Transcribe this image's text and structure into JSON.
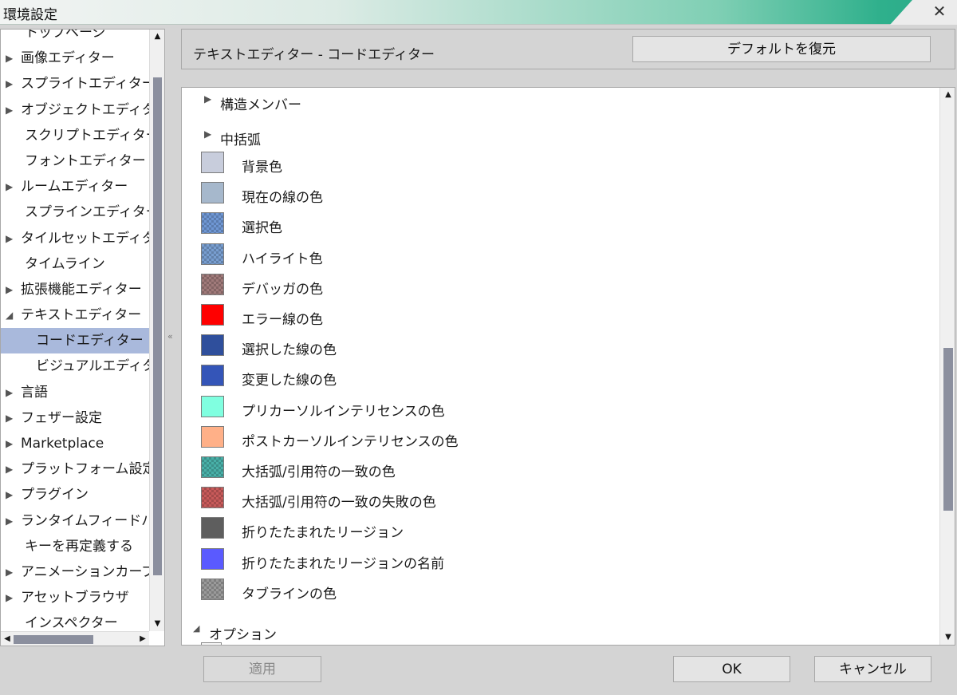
{
  "window": {
    "title": "環境設定",
    "close_symbol": "✕"
  },
  "tree": {
    "items": [
      {
        "label": "トップページ",
        "arrow": false,
        "level": 0,
        "selected": false
      },
      {
        "label": "画像エディター",
        "arrow": true,
        "level": 0,
        "selected": false
      },
      {
        "label": "スプライトエディター",
        "arrow": true,
        "level": 0,
        "selected": false
      },
      {
        "label": "オブジェクトエディター",
        "arrow": true,
        "level": 0,
        "selected": false
      },
      {
        "label": "スクリプトエディター",
        "arrow": false,
        "level": 0,
        "selected": false
      },
      {
        "label": "フォントエディター",
        "arrow": false,
        "level": 0,
        "selected": false
      },
      {
        "label": "ルームエディター",
        "arrow": true,
        "level": 0,
        "selected": false
      },
      {
        "label": "スプラインエディター",
        "arrow": false,
        "level": 0,
        "selected": false
      },
      {
        "label": "タイルセットエディター",
        "arrow": true,
        "level": 0,
        "selected": false
      },
      {
        "label": "タイムライン",
        "arrow": false,
        "level": 0,
        "selected": false
      },
      {
        "label": "拡張機能エディター",
        "arrow": true,
        "level": 0,
        "selected": false
      },
      {
        "label": "テキストエディター",
        "arrow": true,
        "expanded": true,
        "level": 0,
        "selected": false
      },
      {
        "label": "コードエディター",
        "arrow": false,
        "level": 1,
        "selected": true
      },
      {
        "label": "ビジュアルエディター",
        "arrow": false,
        "level": 1,
        "selected": false
      },
      {
        "label": "言語",
        "arrow": true,
        "level": 0,
        "selected": false
      },
      {
        "label": "フェザー設定",
        "arrow": true,
        "level": 0,
        "selected": false
      },
      {
        "label": "Marketplace",
        "arrow": true,
        "level": 0,
        "selected": false
      },
      {
        "label": "プラットフォーム設定",
        "arrow": true,
        "level": 0,
        "selected": false
      },
      {
        "label": "プラグイン",
        "arrow": true,
        "level": 0,
        "selected": false
      },
      {
        "label": "ランタイムフィードバック",
        "arrow": true,
        "level": 0,
        "selected": false
      },
      {
        "label": "キーを再定義する",
        "arrow": false,
        "level": 0,
        "selected": false
      },
      {
        "label": "アニメーションカーブ",
        "arrow": true,
        "level": 0,
        "selected": false
      },
      {
        "label": "アセットブラウザ",
        "arrow": true,
        "level": 0,
        "selected": false
      },
      {
        "label": "インスペクター",
        "arrow": false,
        "level": 0,
        "selected": false
      }
    ]
  },
  "header": {
    "title": "テキストエディター - コードエディター",
    "restore_label": "デフォルトを復元"
  },
  "content": {
    "sections": [
      {
        "label": "構造メンバー"
      },
      {
        "label": "中括弧"
      }
    ],
    "colors": [
      {
        "label": "背景色",
        "color": "#c8cddc",
        "checker": false
      },
      {
        "label": "現在の線の色",
        "color": "#a6b8cc",
        "checker": false
      },
      {
        "label": "選択色",
        "color": "#6f97d4",
        "checker": true
      },
      {
        "label": "ハイライト色",
        "color": "#789ed0",
        "checker": true
      },
      {
        "label": "デバッガの色",
        "color": "#a07a7a",
        "checker": true
      },
      {
        "label": "エラー線の色",
        "color": "#ff0000",
        "checker": false
      },
      {
        "label": "選択した線の色",
        "color": "#2f4f9c",
        "checker": false
      },
      {
        "label": "変更した線の色",
        "color": "#3455b8",
        "checker": false
      },
      {
        "label": "プリカーソルインテリセンスの色",
        "color": "#80ffe0",
        "checker": false
      },
      {
        "label": "ポストカーソルインテリセンスの色",
        "color": "#ffb088",
        "checker": false
      },
      {
        "label": "大括弧/引用符の一致の色",
        "color": "#48b0a8",
        "checker": true
      },
      {
        "label": "大括弧/引用符の一致の失敗の色",
        "color": "#c85a5a",
        "checker": true
      },
      {
        "label": "折りたたまれたリージョン",
        "color": "#5e5e5e",
        "checker": false
      },
      {
        "label": "折りたたまれたリージョンの名前",
        "color": "#5a5aff",
        "checker": false
      },
      {
        "label": "タブラインの色",
        "color": "#9a9a9a",
        "checker": true
      }
    ],
    "options_label": "オプション"
  },
  "buttons": {
    "apply": "適用",
    "ok": "OK",
    "cancel": "キャンセル"
  }
}
